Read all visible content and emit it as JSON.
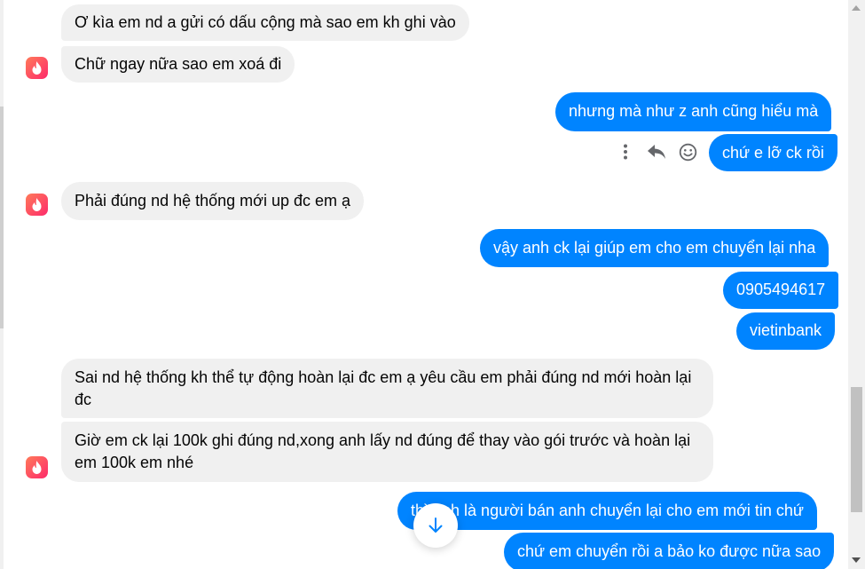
{
  "colors": {
    "incoming_bubble": "#f0f0f0",
    "outgoing_bubble": "#0084ff",
    "avatar_gradient": [
      "#ff7a59",
      "#fd2a6b"
    ]
  },
  "messages": [
    {
      "side": "in",
      "text": "Ơ kìa em nd a gửi có dấu cộng mà sao em kh ghi vào"
    },
    {
      "side": "in",
      "text": "Chữ ngay nữa sao em xoá đi"
    },
    {
      "side": "out",
      "text": "nhưng mà như z anh cũng hiểu mà"
    },
    {
      "side": "out",
      "text": "chứ e lỡ ck rồi"
    },
    {
      "side": "in",
      "text": "Phải đúng nd hệ thống mới up đc em ạ"
    },
    {
      "side": "out",
      "text": "vậy anh ck lại giúp em cho em chuyển lại nha"
    },
    {
      "side": "out",
      "text": "0905494617"
    },
    {
      "side": "out",
      "text": "vietinbank"
    },
    {
      "side": "in",
      "text": "Sai nd hệ thống kh thể tự động hoàn lại đc em ạ yêu cầu em phải đúng nd mới hoàn lại đc"
    },
    {
      "side": "in",
      "text": "Giờ em ck lại 100k ghi đúng nd,xong anh lấy nd đúng để thay vào gói trước và hoàn lại em 100k em nhé"
    },
    {
      "side": "out",
      "text": "thì anh là người bán anh chuyển lại cho em mới tin chứ"
    },
    {
      "side": "out",
      "text": "chứ em chuyển rồi a bảo ko được nữa sao"
    }
  ],
  "icons": {
    "avatar": "flame-icon",
    "more": "more-vertical-icon",
    "reply": "reply-icon",
    "react": "smiley-icon",
    "scroll_down": "arrow-down-icon"
  }
}
